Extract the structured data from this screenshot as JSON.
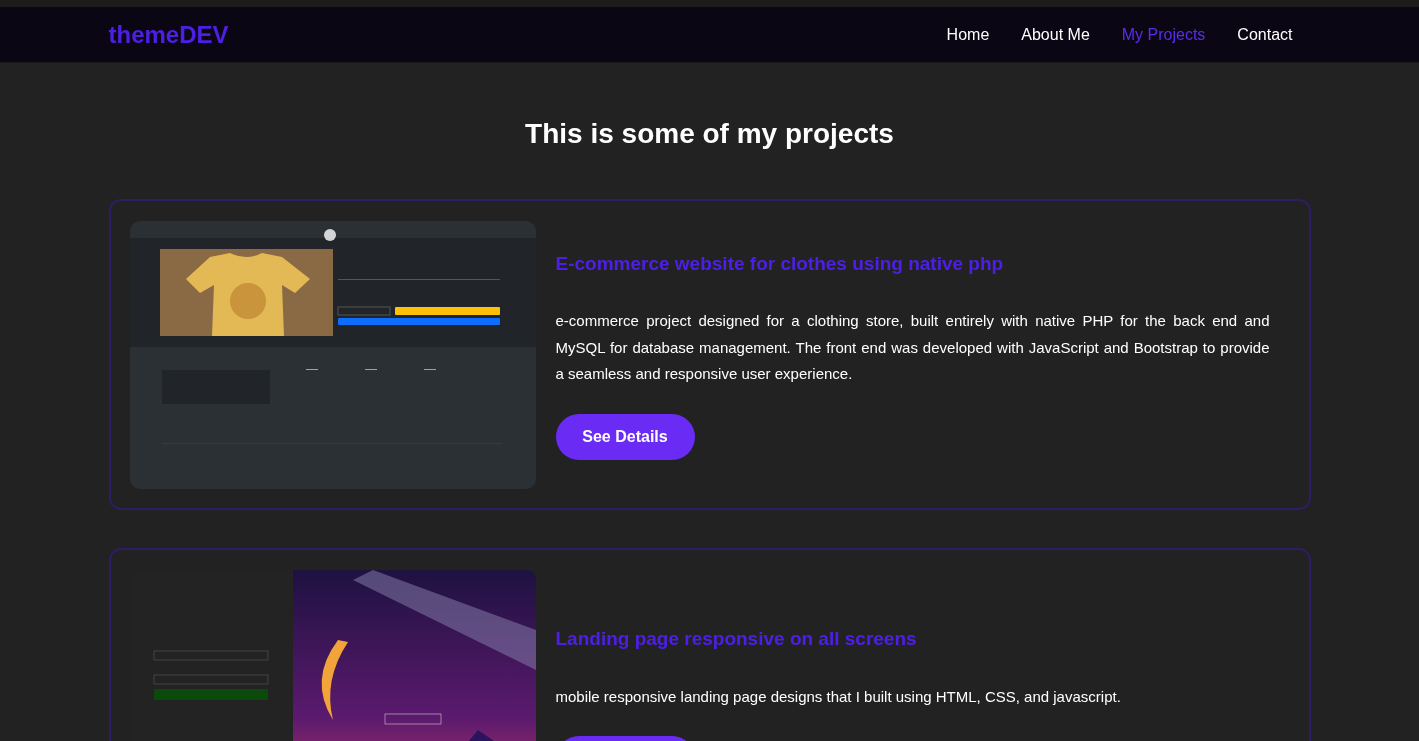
{
  "nav": {
    "logo": "themeDEV",
    "links": [
      {
        "label": "Home",
        "selected": false
      },
      {
        "label": "About Me",
        "selected": false
      },
      {
        "label": "My Projects",
        "selected": true
      },
      {
        "label": "Contact",
        "selected": false
      }
    ]
  },
  "heading": "This is some of my projects",
  "projects": [
    {
      "kind": "shop",
      "title": "E-commerce website for clothes using native php",
      "description": "e-commerce project designed for a clothing store, built entirely with native PHP for the back end and MySQL for database management. The front end was developed with JavaScript and Bootstrap to provide a seamless and responsive user experience.",
      "button_label": "See Details"
    },
    {
      "kind": "landing",
      "title": "Landing page responsive on all screens",
      "description": "mobile responsive landing page designs that I built using HTML, CSS, and javascript."
    }
  ]
}
